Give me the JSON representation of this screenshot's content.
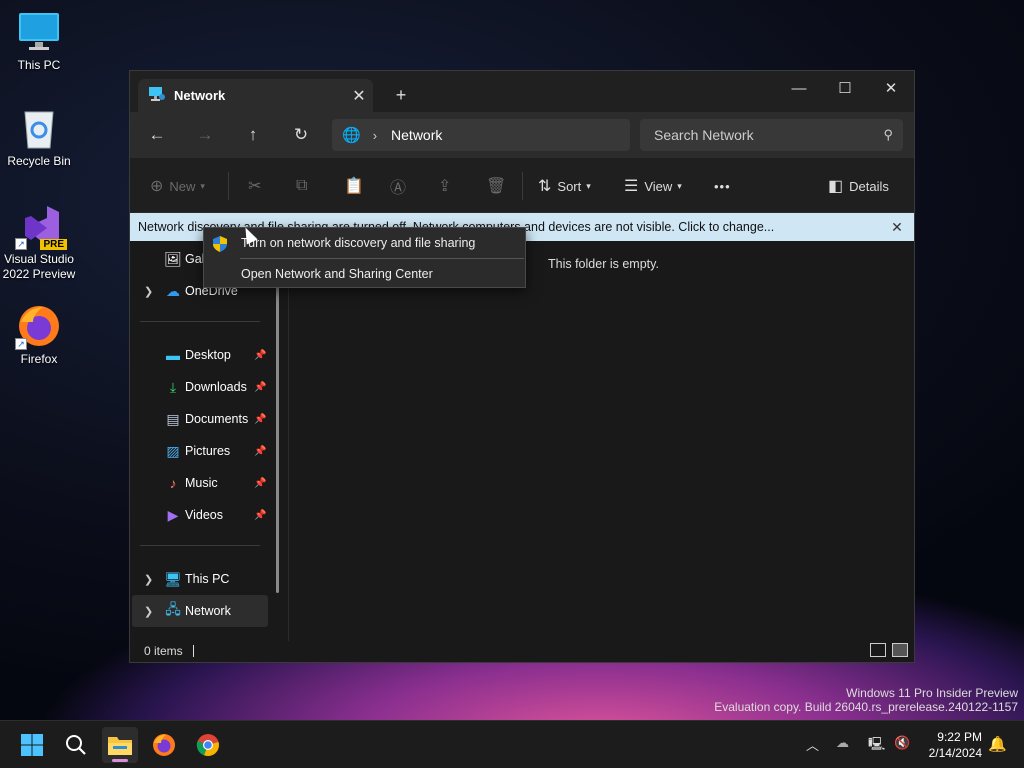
{
  "desktop": {
    "icons": [
      {
        "label": "This PC"
      },
      {
        "label": "Recycle Bin"
      },
      {
        "label": "Visual Studio 2022 Preview",
        "badge": "PRE"
      },
      {
        "label": "Firefox"
      }
    ]
  },
  "window": {
    "tab_title": "Network",
    "tab_close": "✕",
    "new_tab": "+",
    "controls": {
      "minimize": "—",
      "maximize": "☐",
      "close": "✕"
    },
    "address": {
      "path": "Network"
    },
    "search": {
      "placeholder": "Search Network"
    },
    "toolbar": {
      "new_label": "New",
      "sort_label": "Sort",
      "view_label": "View",
      "more_label": "•••",
      "details_label": "Details"
    },
    "infobar": {
      "text": "Network discovery and file sharing are turned off. Network computers and devices are not visible. Click to change...",
      "close": "✕"
    },
    "sidebar": {
      "items": [
        {
          "label": "Gallery"
        },
        {
          "label": "OneDrive"
        },
        {
          "label": "Desktop"
        },
        {
          "label": "Downloads"
        },
        {
          "label": "Documents"
        },
        {
          "label": "Pictures"
        },
        {
          "label": "Music"
        },
        {
          "label": "Videos"
        },
        {
          "label": "This PC"
        },
        {
          "label": "Network"
        }
      ]
    },
    "content": {
      "empty_message": "This folder is empty."
    },
    "status": {
      "items_count": "0 items"
    }
  },
  "context_menu": {
    "items": [
      {
        "label": "Turn on network discovery and file sharing"
      },
      {
        "label": "Open Network and Sharing Center"
      }
    ]
  },
  "watermark": {
    "line1": "Windows 11 Pro Insider Preview",
    "line2": "Evaluation copy. Build 26040.rs_prerelease.240122-1157"
  },
  "taskbar": {
    "time": "9:22 PM",
    "date": "2/14/2024"
  },
  "colors": {
    "accent": "#0078d4",
    "infobar_bg": "#cfe7f5",
    "window_bg": "#191919"
  }
}
